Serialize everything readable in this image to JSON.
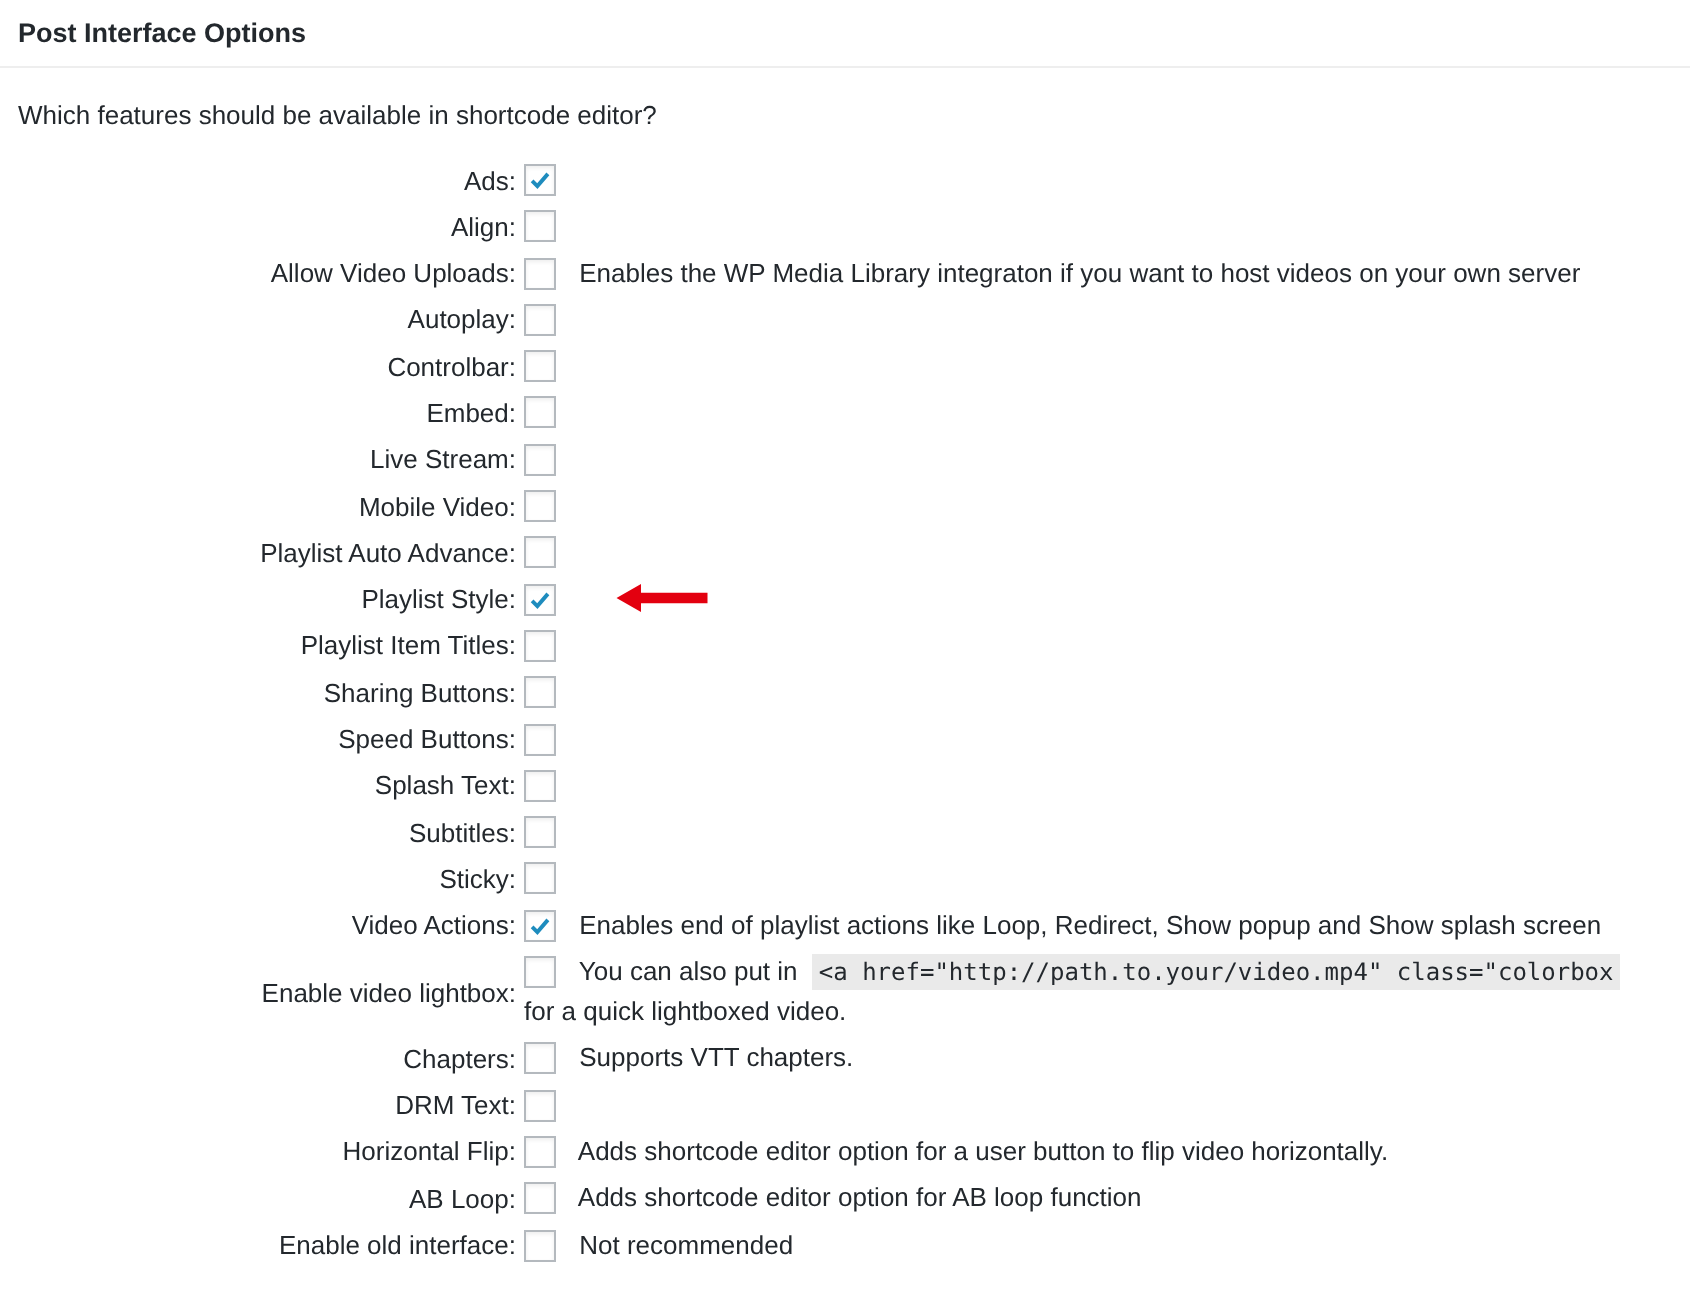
{
  "section": {
    "title": "Post Interface Options"
  },
  "question": "Which features should be available in shortcode editor?",
  "options": [
    {
      "label": "Ads:",
      "checked": true,
      "arrow": false
    },
    {
      "label": "Align:",
      "checked": false,
      "arrow": false
    },
    {
      "label": "Allow Video Uploads:",
      "checked": false,
      "arrow": false,
      "description": "Enables the WP Media Library integraton if you want to host videos on your own server"
    },
    {
      "label": "Autoplay:",
      "checked": false,
      "arrow": false
    },
    {
      "label": "Controlbar:",
      "checked": false,
      "arrow": false
    },
    {
      "label": "Embed:",
      "checked": false,
      "arrow": false
    },
    {
      "label": "Live Stream:",
      "checked": false,
      "arrow": false
    },
    {
      "label": "Mobile Video:",
      "checked": false,
      "arrow": false
    },
    {
      "label": "Playlist Auto Advance:",
      "checked": false,
      "arrow": false
    },
    {
      "label": "Playlist Style:",
      "checked": true,
      "arrow": true
    },
    {
      "label": "Playlist Item Titles:",
      "checked": false,
      "arrow": false
    },
    {
      "label": "Sharing Buttons:",
      "checked": false,
      "arrow": false
    },
    {
      "label": "Speed Buttons:",
      "checked": false,
      "arrow": false
    },
    {
      "label": "Splash Text:",
      "checked": false,
      "arrow": false
    },
    {
      "label": "Subtitles:",
      "checked": false,
      "arrow": false
    },
    {
      "label": "Sticky:",
      "checked": false,
      "arrow": false
    },
    {
      "label": "Video Actions:",
      "checked": true,
      "arrow": false,
      "description": "Enables end of playlist actions like Loop, Redirect, Show popup and Show splash screen"
    },
    {
      "label": "Enable video lightbox:",
      "checked": false,
      "arrow": false,
      "description": "You can also put in",
      "code": "<a href=\"http://path.to.your/video.mp4\" class=\"colorbox",
      "description_after": "for a quick lightboxed video."
    },
    {
      "label": "Chapters:",
      "checked": false,
      "arrow": false,
      "description": "Supports VTT chapters."
    },
    {
      "label": "DRM Text:",
      "checked": false,
      "arrow": false
    },
    {
      "label": "Horizontal Flip:",
      "checked": false,
      "arrow": false,
      "description": "Adds shortcode editor option for a user button to flip video horizontally."
    },
    {
      "label": "AB Loop:",
      "checked": false,
      "arrow": false,
      "description": "Adds shortcode editor option for AB loop function"
    },
    {
      "label": "Enable old interface:",
      "checked": false,
      "arrow": false,
      "description": "Not recommended"
    }
  ]
}
